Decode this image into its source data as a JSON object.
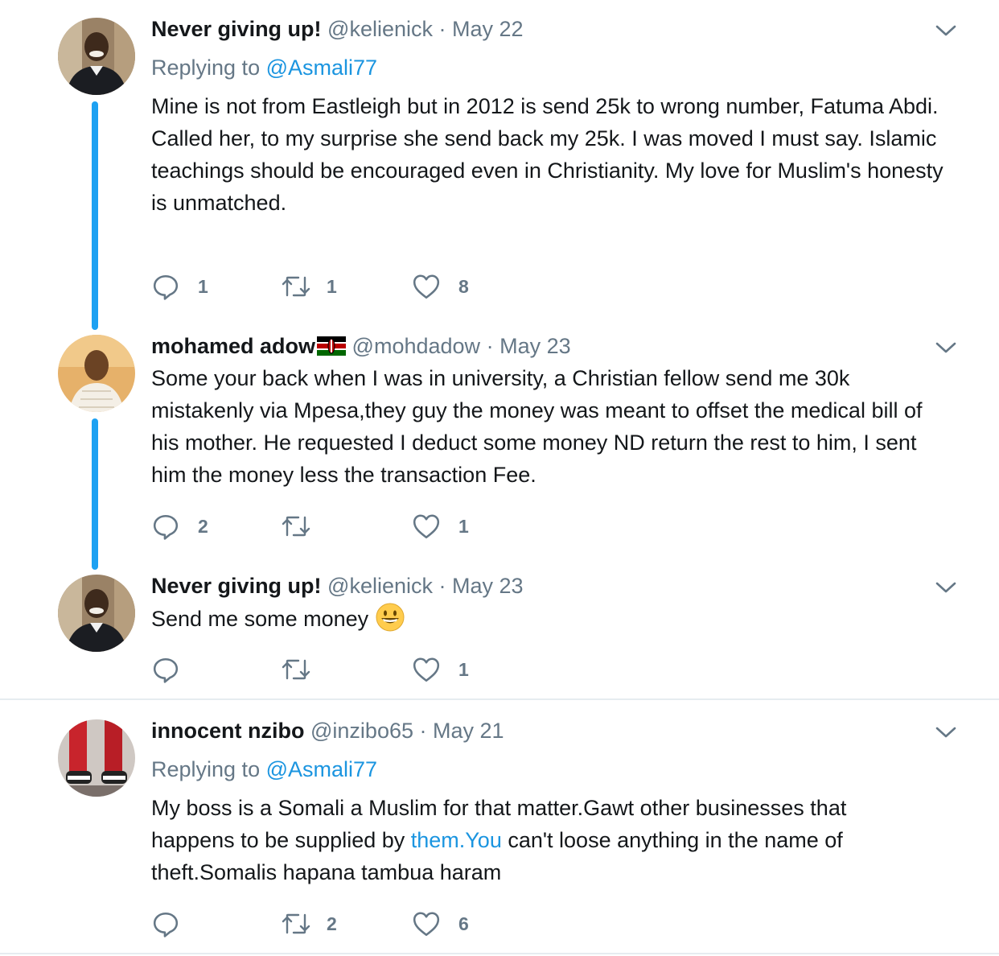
{
  "tweets": [
    {
      "name": "Never giving up!",
      "handle": "@kelienick",
      "sep": "·",
      "date": "May 22",
      "replying_prefix": "Replying to",
      "replying_to": "@Asmali77",
      "lines": [
        "Mine is not from Eastleigh but in 2012 is send 25k to wrong number, Fatuma Abdi.",
        "Called her, to my surprise she send back my 25k. I was moved I must say. Islamic teachings should be encouraged even in Christianity. My love for Muslim's honesty is unmatched."
      ],
      "replies": "1",
      "retweets": "1",
      "likes": "8"
    },
    {
      "name": "mohamed adow",
      "handle": "@mohdadow",
      "sep": "·",
      "date": "May 23",
      "text": "Some your back when I was in university, a Christian fellow send me 30k mistakenly via Mpesa,they guy the money was meant to offset the medical bill of his mother. He requested I deduct some money ND return the rest to him, I sent him the money less the transaction Fee.",
      "replies": "2",
      "retweets": "",
      "likes": "1"
    },
    {
      "name": "Never giving up!",
      "handle": "@kelienick",
      "sep": "·",
      "date": "May 23",
      "text": "Send me some money",
      "replies": "",
      "retweets": "",
      "likes": "1"
    },
    {
      "name": "innocent nzibo",
      "handle": "@inzibo65",
      "sep": "·",
      "date": "May 21",
      "replying_prefix": "Replying to",
      "replying_to": "@Asmali77",
      "text_before": "My boss is a Somali a Muslim for that matter.Gawt other businesses that happens to be supplied by ",
      "text_link": "them.You",
      "text_after": " can't loose anything in the name of theft.Somalis hapana tambua haram",
      "replies": "",
      "retweets": "2",
      "likes": "6"
    }
  ],
  "icons": {
    "reply": "reply-icon",
    "retweet": "retweet-icon",
    "like": "heart-icon",
    "caret": "chevron-down-icon",
    "flag": "kenya-flag-icon",
    "emoji": "grinning-face-emoji"
  },
  "colors": {
    "accent": "#1da1f2",
    "muted": "#657786",
    "link": "#1b95e0"
  }
}
